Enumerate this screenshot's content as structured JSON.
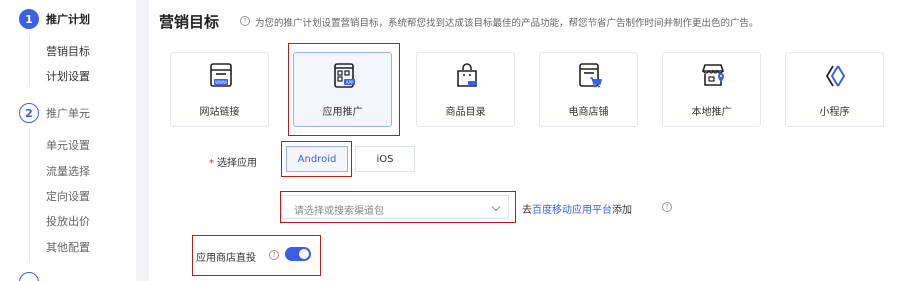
{
  "sidebar": {
    "steps": [
      {
        "num": "1",
        "label": "推广计划",
        "items": [
          "营销目标",
          "计划设置"
        ]
      },
      {
        "num": "2",
        "label": "推广单元",
        "items": [
          "单元设置",
          "流量选择",
          "定向设置",
          "投放出价",
          "其他配置"
        ]
      }
    ]
  },
  "main": {
    "title": "营销目标",
    "help": "?",
    "description": "为您的推广计划设置营销目标，系统帮您找到达成该目标最佳的产品功能，帮您节省广告制作时间并制作更出色的广告。",
    "cards": [
      {
        "label": "网站链接",
        "icon": "www-window-icon"
      },
      {
        "label": "应用推广",
        "icon": "app-grid-icon"
      },
      {
        "label": "商品目录",
        "icon": "shopping-bag-icon"
      },
      {
        "label": "电商店铺",
        "icon": "ecommerce-cart-icon"
      },
      {
        "label": "本地推广",
        "icon": "local-store-icon"
      },
      {
        "label": "小程序",
        "icon": "mini-program-icon"
      }
    ],
    "select_app": {
      "label": "选择应用",
      "options": [
        "Android",
        "iOS"
      ],
      "selected": "Android"
    },
    "channel": {
      "placeholder": "请选择或搜索渠道包",
      "prefix": "去",
      "link": "百度移动应用平台",
      "suffix": "添加"
    },
    "direct": {
      "label": "应用商店直投",
      "enabled": true
    }
  },
  "colors": {
    "accent": "#3a60e6",
    "highlight_box": "#c0191c"
  }
}
